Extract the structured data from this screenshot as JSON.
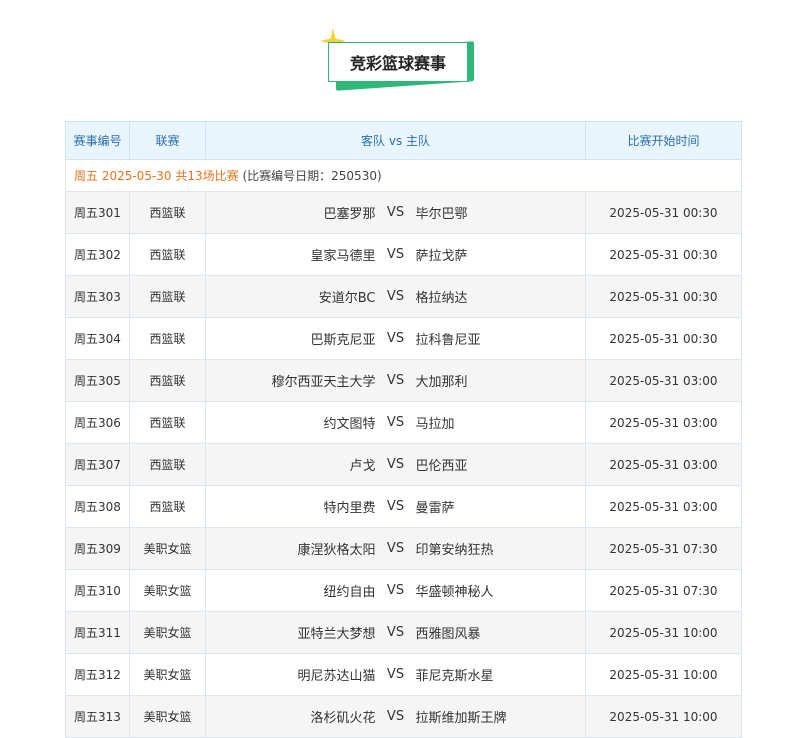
{
  "title": "竞彩篮球赛事",
  "headers": {
    "number": "赛事编号",
    "league": "联赛",
    "teams": "客队 vs 主队",
    "time": "比赛开始时间"
  },
  "info_line": {
    "date_text": "周五 2025-05-30 共13场比赛",
    "sub_text": "(比赛编号日期：250530)"
  },
  "vs_label": "VS",
  "matches": [
    {
      "id": "周五301",
      "league": "西篮联",
      "home": "巴塞罗那",
      "away": "毕尔巴鄂",
      "time": "2025-05-31 00:30"
    },
    {
      "id": "周五302",
      "league": "西篮联",
      "home": "皇家马德里",
      "away": "萨拉戈萨",
      "time": "2025-05-31 00:30"
    },
    {
      "id": "周五303",
      "league": "西篮联",
      "home": "安道尔BC",
      "away": "格拉纳达",
      "time": "2025-05-31 00:30"
    },
    {
      "id": "周五304",
      "league": "西篮联",
      "home": "巴斯克尼亚",
      "away": "拉科鲁尼亚",
      "time": "2025-05-31 00:30"
    },
    {
      "id": "周五305",
      "league": "西篮联",
      "home": "穆尔西亚天主大学",
      "away": "大加那利",
      "time": "2025-05-31 03:00"
    },
    {
      "id": "周五306",
      "league": "西篮联",
      "home": "约文图特",
      "away": "马拉加",
      "time": "2025-05-31 03:00"
    },
    {
      "id": "周五307",
      "league": "西篮联",
      "home": "卢戈",
      "away": "巴伦西亚",
      "time": "2025-05-31 03:00"
    },
    {
      "id": "周五308",
      "league": "西篮联",
      "home": "特内里费",
      "away": "曼雷萨",
      "time": "2025-05-31 03:00"
    },
    {
      "id": "周五309",
      "league": "美职女篮",
      "home": "康涅狄格太阳",
      "away": "印第安纳狂热",
      "time": "2025-05-31 07:30"
    },
    {
      "id": "周五310",
      "league": "美职女篮",
      "home": "纽约自由",
      "away": "华盛顿神秘人",
      "time": "2025-05-31 07:30"
    },
    {
      "id": "周五311",
      "league": "美职女篮",
      "home": "亚特兰大梦想",
      "away": "西雅图风暴",
      "time": "2025-05-31 10:00"
    },
    {
      "id": "周五312",
      "league": "美职女篮",
      "home": "明尼苏达山猫",
      "away": "菲尼克斯水星",
      "time": "2025-05-31 10:00"
    },
    {
      "id": "周五313",
      "league": "美职女篮",
      "home": "洛杉矶火花",
      "away": "拉斯维加斯王牌",
      "time": "2025-05-31 10:00"
    }
  ],
  "colors": {
    "accent_green": "#2db87a",
    "header_bg": "#e9f5fd",
    "header_text": "#2a6fb0",
    "info_orange": "#e8731f",
    "spark_yellow": "#f5d33a"
  }
}
